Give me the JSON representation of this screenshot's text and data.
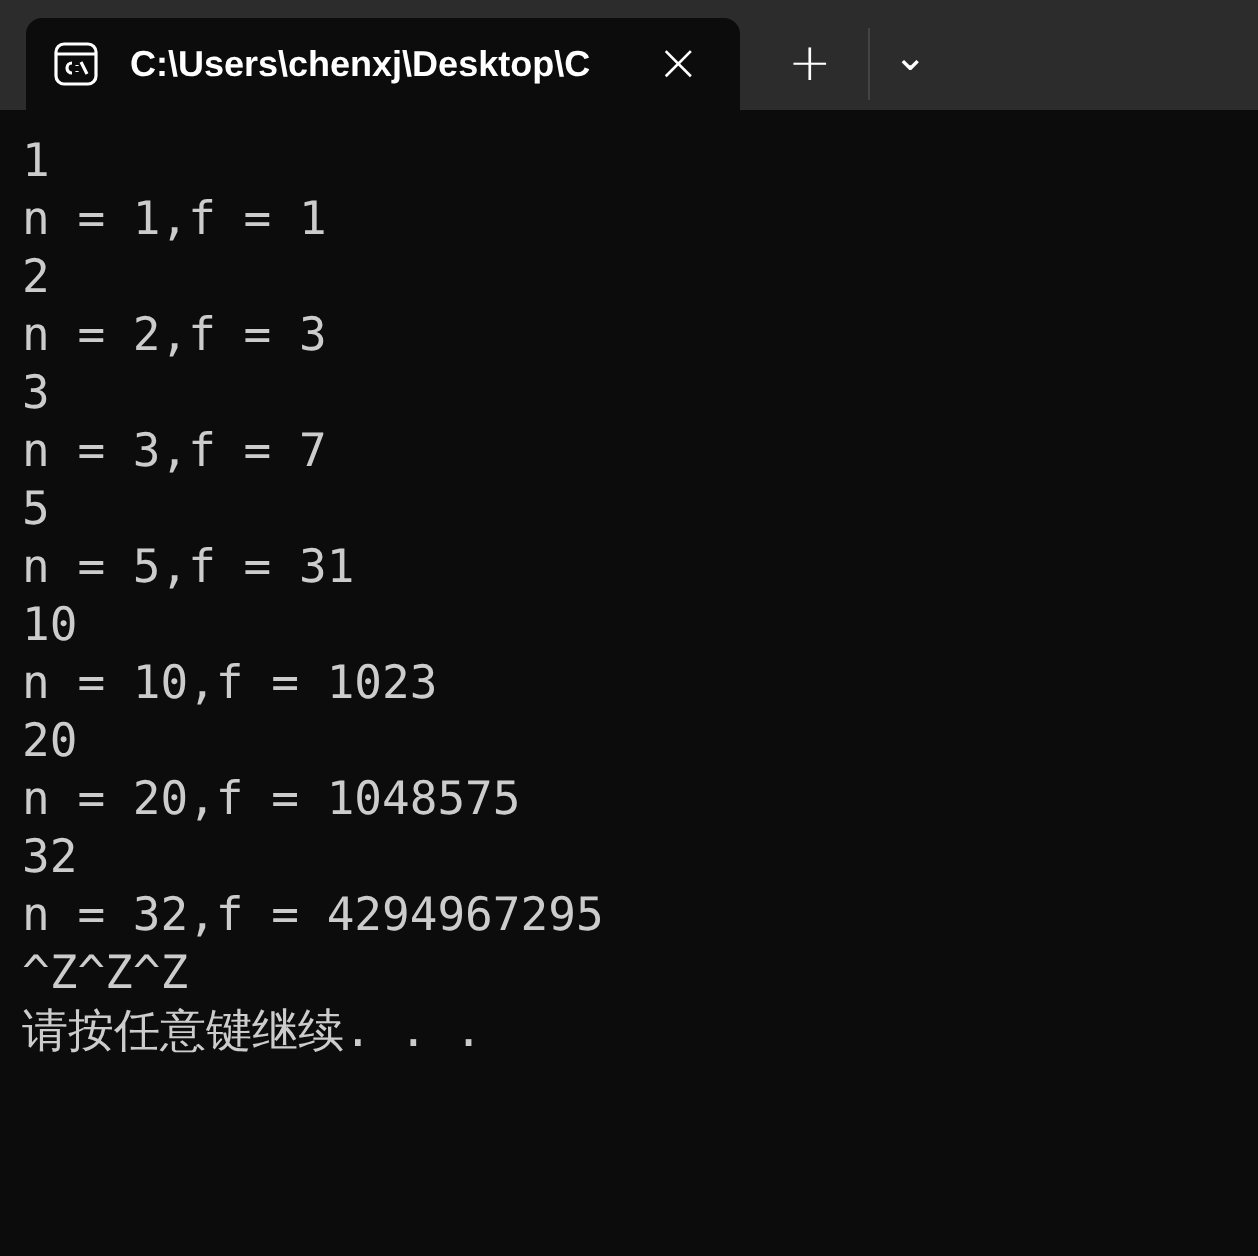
{
  "tab": {
    "title": "C:\\Users\\chenxj\\Desktop\\C",
    "close": "×",
    "selected": true
  },
  "toolbar": {
    "new_tab": "+",
    "dropdown": "⌄"
  },
  "terminal": {
    "lines": [
      "1",
      "n = 1,f = 1",
      "2",
      "n = 2,f = 3",
      "3",
      "n = 3,f = 7",
      "5",
      "n = 5,f = 31",
      "10",
      "n = 10,f = 1023",
      "20",
      "n = 20,f = 1048575",
      "32",
      "n = 32,f = 4294967295",
      "^Z^Z^Z",
      "请按任意键继续. . ."
    ]
  }
}
